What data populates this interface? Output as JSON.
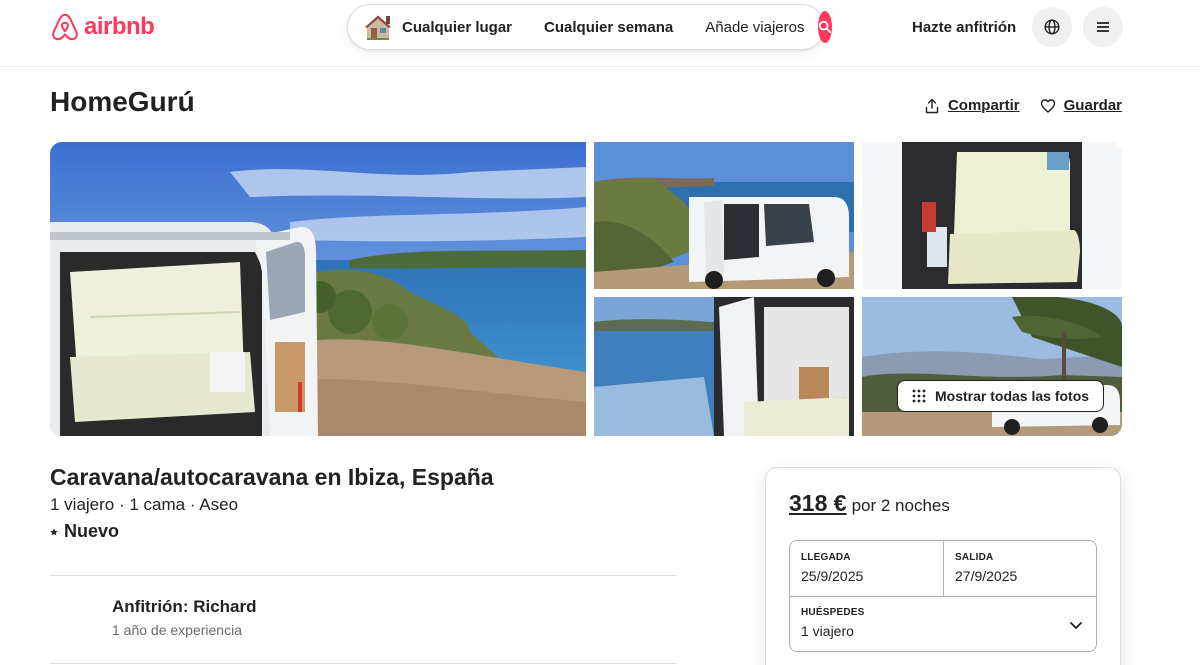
{
  "header": {
    "brand": "airbnb",
    "brand_color": "#ff385c",
    "search": {
      "place": "Cualquier lugar",
      "week": "Cualquier semana",
      "guests": "Añade viajeros",
      "place_icon": "house-icon",
      "button_icon": "search-icon"
    },
    "host_link": "Hazte anfitrión",
    "language_icon": "globe-icon",
    "menu_icon": "hamburger-menu-icon"
  },
  "listing": {
    "title": "HomeGurú",
    "share_label": "Compartir",
    "save_label": "Guardar",
    "show_all_photos": "Mostrar todas las fotos",
    "subtitle": "Caravana/autocaravana en Ibiza, España",
    "overview": "1 viajero · 1 cama · Aseo",
    "rating_label": "Nuevo",
    "host_name": "Anfitrión: Richard",
    "host_experience": "1 año de experiencia"
  },
  "booking": {
    "price": "318 €",
    "per": "por 2 noches",
    "checkin_label": "LLEGADA",
    "checkin_value": "25/9/2025",
    "checkout_label": "SALIDA",
    "checkout_value": "27/9/2025",
    "guests_label": "HUÉSPEDES",
    "guests_value": "1 viajero"
  }
}
